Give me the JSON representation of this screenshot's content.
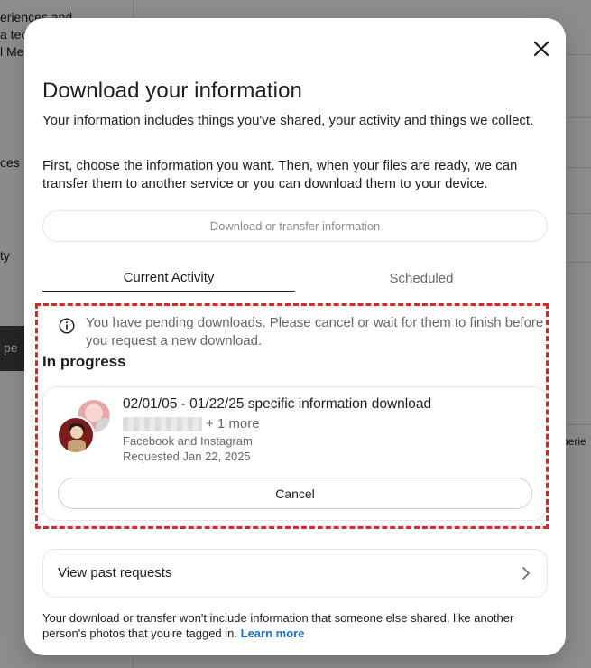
{
  "background": {
    "left_texts": [
      "eriences and",
      "a tec",
      "l Me",
      "ces",
      "ty",
      "pe"
    ],
    "right_text": "perie"
  },
  "modal": {
    "title": "Download your information",
    "intro": "Your information includes things you've shared, your activity and things we collect.",
    "instructions": "First, choose the information you want. Then, when your files are ready, we can transfer them to another service or you can download them to your device.",
    "download_button_label": "Download or transfer information",
    "tabs": [
      {
        "label": "Current Activity",
        "selected": true
      },
      {
        "label": "Scheduled",
        "selected": false
      }
    ],
    "notice": "You have pending downloads. Please cancel or wait for them to finish before you request a new download.",
    "section_heading": "In progress",
    "request": {
      "title": "02/01/05 - 01/22/25 specific information download",
      "more_accounts": "+ 1 more",
      "platforms": "Facebook and Instagram",
      "requested": "Requested Jan 22, 2025",
      "cancel_label": "Cancel"
    },
    "past_requests_label": "View past requests",
    "footer_text": "Your download or transfer won't include information that someone else shared, like another person's photos that you're tagged in.",
    "learn_more_label": "Learn more"
  },
  "icons": {
    "close": "close-icon",
    "info": "info-icon",
    "chevron": "chevron-right-icon"
  },
  "colors": {
    "link": "#1b6fd8",
    "highlight": "#e02424",
    "muted_text": "#65676b"
  }
}
